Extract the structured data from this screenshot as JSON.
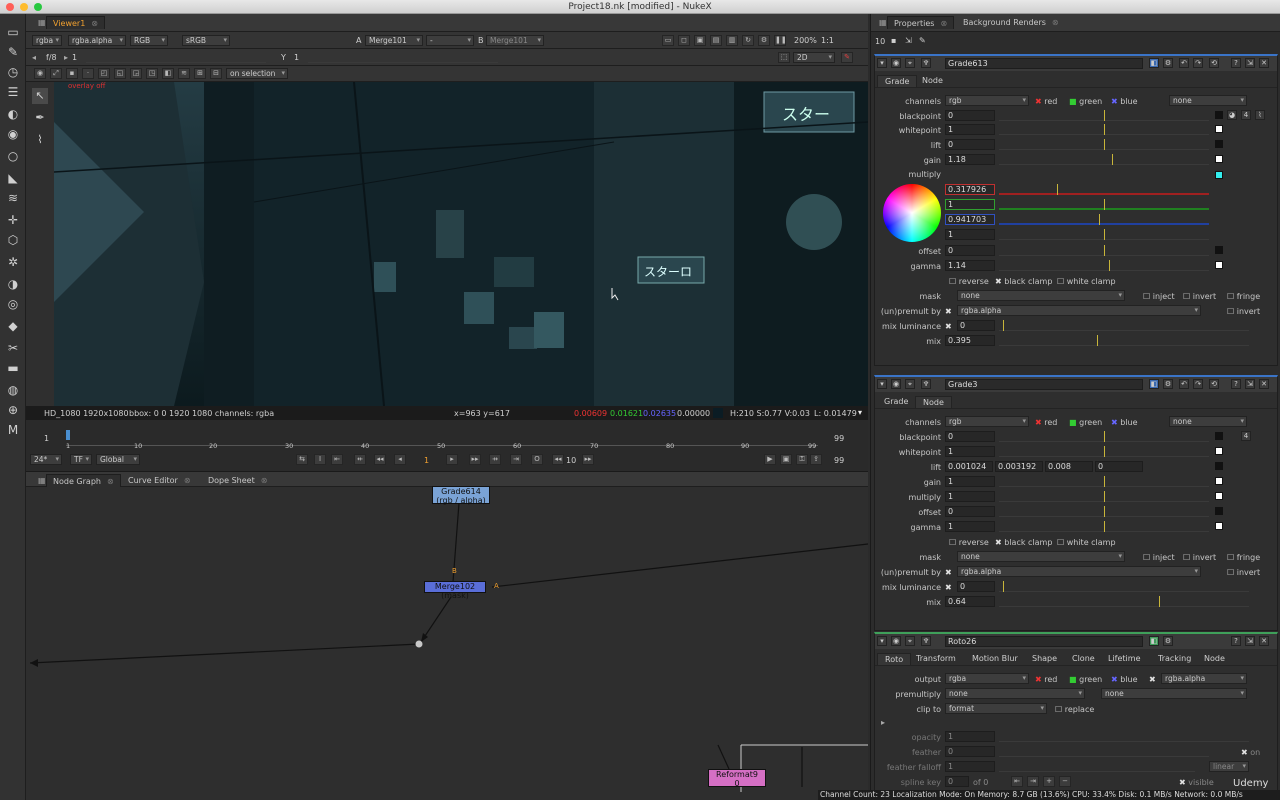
{
  "window": {
    "title": "Project18.nk [modified] - NukeX"
  },
  "viewer_tabs": {
    "viewer": "Viewer1"
  },
  "viewer_bar1": {
    "channels": "rgba",
    "alpha": "rgba.alpha",
    "color": "RGB",
    "lut": "sRGB",
    "a_label": "A",
    "a_input": "Merge101",
    "dash": "-",
    "b_label": "B",
    "b_input": "Merge101",
    "zoom": "200%",
    "ratio": "1:1"
  },
  "viewer_bar2": {
    "fstop": "f/8",
    "fstop_val": "1",
    "y_label": "Y",
    "y_val": "1",
    "view_mode": "2D"
  },
  "viewer_bar3": {
    "selection_mode": "on selection"
  },
  "viewer_overlay": {
    "overlay_text": "overlay off"
  },
  "viewer_info": {
    "format": "HD_1080 1920x1080",
    "bbox": "bbox: 0 0 1920 1080 channels: rgba",
    "coords": "x=963 y=617",
    "r": "0.00609",
    "g": "0.01621",
    "b": "0.02635",
    "a": "0.00000",
    "hsv": "H:210 S:0.77 V:0.03",
    "lum": "L: 0.01479"
  },
  "timeline": {
    "start": "1",
    "end": "99",
    "end_right": "99",
    "ticks": [
      "1",
      "10",
      "20",
      "30",
      "40",
      "50",
      "60",
      "70",
      "80",
      "90",
      "99"
    ],
    "fps": "24*",
    "tf": "TF",
    "global": "Global",
    "frame": "1",
    "step": "10",
    "last": "99"
  },
  "node_tabs": [
    "Node Graph",
    "Curve Editor",
    "Dope Sheet"
  ],
  "nodes": {
    "grade614": "Grade614",
    "grade614_sub": "(rgb / alpha)",
    "merge102": "Merge102 (mask)",
    "merge_b": "B",
    "merge_a": "A",
    "reformat": "Reformat9",
    "reformat_sub": "0"
  },
  "props_tabs": [
    "Properties",
    "Background Renders"
  ],
  "props_max": "10",
  "grade613": {
    "name": "Grade613",
    "tabs": [
      "Grade",
      "Node"
    ],
    "channels_label": "channels",
    "channels": "rgb",
    "red": "red",
    "green": "green",
    "blue": "blue",
    "none": "none",
    "rows": [
      {
        "label": "blackpoint",
        "value": "0"
      },
      {
        "label": "whitepoint",
        "value": "1"
      },
      {
        "label": "lift",
        "value": "0"
      },
      {
        "label": "gain",
        "value": "1.18"
      },
      {
        "label": "multiply",
        "value": ""
      }
    ],
    "mult_r": "0.317926",
    "mult_g": "1",
    "mult_b": "0.941703",
    "mult_a": "1",
    "offset_label": "offset",
    "offset": "0",
    "gamma_label": "gamma",
    "gamma": "1.14",
    "reverse": "reverse",
    "black_clamp": "black clamp",
    "white_clamp": "white clamp",
    "mask_label": "mask",
    "mask": "none",
    "inject": "inject",
    "invert": "invert",
    "fringe": "fringe",
    "premult_label": "(un)premult by",
    "premult": "rgba.alpha",
    "invert2": "invert",
    "mixlum_label": "mix luminance",
    "mixlum": "0",
    "mix_label": "mix",
    "mix": "0.395",
    "count": "4"
  },
  "grade3": {
    "name": "Grade3",
    "tabs": [
      "Grade",
      "Node"
    ],
    "channels_label": "channels",
    "channels": "rgb",
    "red": "red",
    "green": "green",
    "blue": "blue",
    "none": "none",
    "rows": [
      {
        "label": "blackpoint",
        "value": "0"
      },
      {
        "label": "whitepoint",
        "value": "1"
      }
    ],
    "lift_label": "lift",
    "lift": [
      "0.001024",
      "0.003192",
      "0.008",
      "0"
    ],
    "rows2": [
      {
        "label": "gain",
        "value": "1"
      },
      {
        "label": "multiply",
        "value": "1"
      },
      {
        "label": "offset",
        "value": "0"
      },
      {
        "label": "gamma",
        "value": "1"
      }
    ],
    "reverse": "reverse",
    "black_clamp": "black clamp",
    "white_clamp": "white clamp",
    "mask_label": "mask",
    "mask": "none",
    "inject": "inject",
    "invert": "invert",
    "fringe": "fringe",
    "premult_label": "(un)premult by",
    "premult": "rgba.alpha",
    "invert2": "invert",
    "mixlum_label": "mix luminance",
    "mixlum": "0",
    "mix_label": "mix",
    "mix": "0.64",
    "count": "4"
  },
  "roto26": {
    "name": "Roto26",
    "tabs": [
      "Roto",
      "Transform",
      "Motion Blur",
      "Shape",
      "Clone",
      "Lifetime",
      "Tracking",
      "Node"
    ],
    "output_label": "output",
    "output": "rgba",
    "red": "red",
    "green": "green",
    "blue": "blue",
    "alpha": "rgba.alpha",
    "premult_label": "premultiply",
    "premult": "none",
    "premult2": "none",
    "clip_label": "clip to",
    "clip": "format",
    "replace": "replace",
    "opacity_label": "opacity",
    "opacity": "1",
    "feather_label": "feather",
    "feather": "0",
    "falloff_label": "feather falloff",
    "falloff": "1",
    "falloff_type": "linear",
    "on": "on",
    "splinekey_label": "spline key",
    "splinekey": "0",
    "of": "of 0",
    "visible": "visible"
  },
  "slider_ticks_a": [
    "-1",
    "-0.7",
    "-0.4",
    "-0.1",
    "0.1",
    "0.4",
    "0.7",
    "1"
  ],
  "slider_ticks_b": [
    "0",
    "0.1",
    "0.4",
    "0.7",
    "1",
    "2",
    "3",
    "4"
  ],
  "slider_ticks_c": [
    "0",
    "0.1",
    "0.2",
    "0.3",
    "0.4",
    "0.5",
    "0.6",
    "0.7",
    "0.8",
    "0.9",
    "1"
  ],
  "slider_ticks_d": [
    "0.2",
    "0.3",
    "0.4",
    "0.5",
    "0.7",
    "1",
    "2",
    "3",
    "4",
    "5"
  ],
  "slider_ticks_e": [
    "-1",
    "-0.5",
    "0",
    "0.5",
    "1",
    "1.5",
    "2",
    "2.5"
  ],
  "statusbar": {
    "text": "Channel Count: 23  Localization Mode: On  Memory: 8.7 GB (13.6%)  CPU: 33.4%  Disk: 0.1 MB/s  Network: 0.0 MB/s"
  },
  "watermark": "Udemy",
  "colors": {
    "accent_orange": "#f0a030",
    "red_dot": "#ff5f57",
    "yellow_dot": "#febc2e",
    "green_dot": "#28c840",
    "node_blue": "#7aa3d6",
    "node_merge": "#5a6ed8",
    "node_pink": "#d56fc4"
  }
}
